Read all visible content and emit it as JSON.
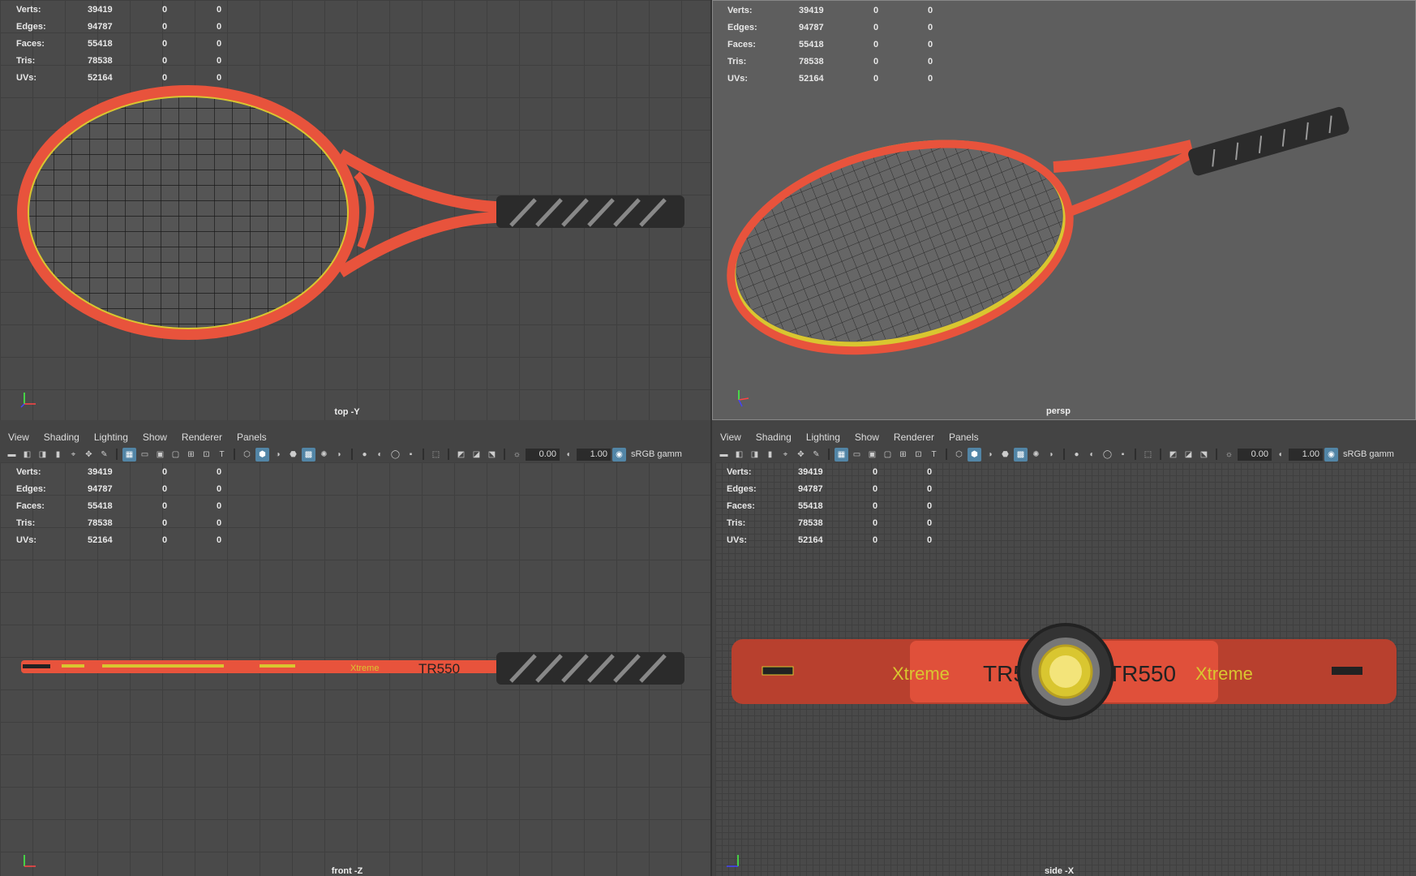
{
  "stats": {
    "rows": [
      {
        "label": "Verts:",
        "v1": "39419",
        "v2": "0",
        "v3": "0"
      },
      {
        "label": "Edges:",
        "v1": "94787",
        "v2": "0",
        "v3": "0"
      },
      {
        "label": "Faces:",
        "v1": "55418",
        "v2": "0",
        "v3": "0"
      },
      {
        "label": "Tris:",
        "v1": "78538",
        "v2": "0",
        "v3": "0"
      },
      {
        "label": "UVs:",
        "v1": "52164",
        "v2": "0",
        "v3": "0"
      }
    ]
  },
  "viewports": {
    "top": {
      "label": "top -Y"
    },
    "persp": {
      "label": "persp"
    },
    "front": {
      "label": "front -Z"
    },
    "side": {
      "label": "side -X"
    }
  },
  "menu": [
    "View",
    "Shading",
    "Lighting",
    "Show",
    "Renderer",
    "Panels"
  ],
  "toolbar": {
    "exposure": "0.00",
    "gamma_value": "1.00",
    "color_space": "sRGB gamm"
  },
  "racket_text": {
    "brand": "Xtreme",
    "model": "TR550",
    "model_small": "TR550"
  },
  "colors": {
    "frame": "#e8533c",
    "accent": "#d9c630",
    "grip": "#2b2b2b",
    "toolbar_active": "#5285a6"
  }
}
